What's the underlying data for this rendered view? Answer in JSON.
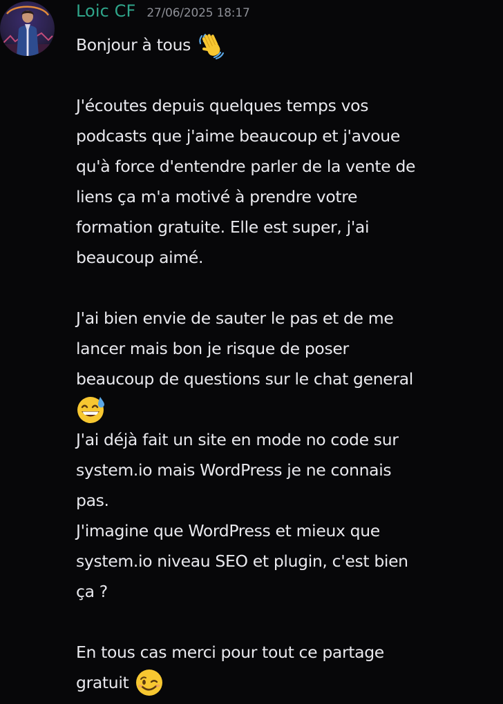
{
  "message": {
    "author": "Loic CF",
    "timestamp": "27/06/2025 18:17",
    "colors": {
      "username": "#2fa58a",
      "timestamp": "#8d8f96",
      "text": "#e9e9ee",
      "background": "#070709"
    },
    "lines": [
      "Bonjour à tous",
      "",
      "J'écoutes depuis quelques temps vos",
      "podcasts que j'aime beaucoup et j'avoue",
      "qu'à force d'entendre parler de la vente de",
      "liens ça m'a motivé à prendre votre",
      "formation gratuite. Elle est super, j'ai",
      "beaucoup aimé.",
      "",
      "J'ai bien envie de sauter le pas et de me",
      "lancer mais bon je risque de poser",
      "beaucoup de questions sur le chat general",
      "",
      "J'ai déjà fait un site en mode no code sur",
      "system.io mais WordPress je ne connais",
      "pas.",
      "J'imagine que WordPress et mieux que",
      "system.io niveau SEO et plugin, c'est bien",
      "ça ?",
      "",
      "En tous cas merci pour tout ce partage",
      "gratuit"
    ],
    "emojis": {
      "greeting": "waving-hand-emoji",
      "sweat": "grinning-face-with-sweat-emoji",
      "wink": "winking-face-emoji"
    }
  }
}
